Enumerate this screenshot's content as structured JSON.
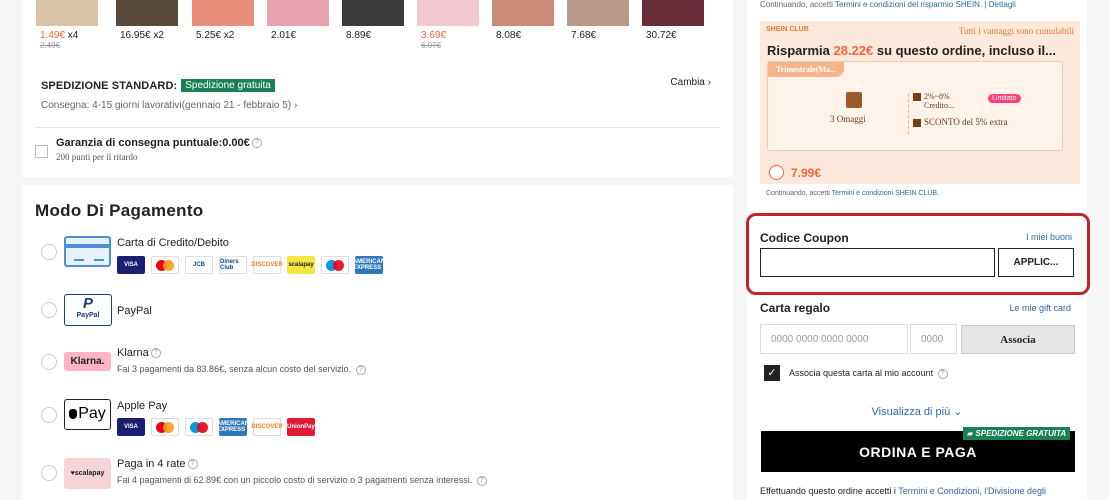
{
  "products": [
    {
      "price": "1.49€",
      "qty": "x4",
      "old": "2.49€",
      "sale": true,
      "color": "#d9c3a8"
    },
    {
      "price": "16.95€",
      "qty": "x2",
      "old": "",
      "sale": false,
      "color": "#5a4a3a"
    },
    {
      "price": "5.25€",
      "qty": "x2",
      "old": "",
      "sale": false,
      "color": "#e88e7a"
    },
    {
      "price": "2.01€",
      "qty": "",
      "old": "",
      "sale": false,
      "color": "#e9a3b0"
    },
    {
      "price": "8.89€",
      "qty": "",
      "old": "",
      "sale": false,
      "color": "#3b3b3b"
    },
    {
      "price": "3.69€",
      "qty": "",
      "old": "6.07€",
      "sale": true,
      "color": "#f2c8d2"
    },
    {
      "price": "8.08€",
      "qty": "",
      "old": "",
      "sale": false,
      "color": "#c98a78"
    },
    {
      "price": "7.68€",
      "qty": "",
      "old": "",
      "sale": false,
      "color": "#b99a8a"
    },
    {
      "price": "30.72€",
      "qty": "",
      "old": "",
      "sale": false,
      "color": "#6a2d3a"
    }
  ],
  "shipping": {
    "name": "SPEDIZIONE STANDARD:",
    "badge": "Spedizione gratuita",
    "eta": "Consegna: 4-15 giorni lavorativi(gennaio 21 - febbraio 5)",
    "change": "Cambia"
  },
  "guarantee": {
    "title": "Garanzia di consegna puntuale:0.00€",
    "sub": "200 punti per il ritardo"
  },
  "payment": {
    "title": "Modo Di Pagamento",
    "methods": {
      "card": {
        "name": "Carta di Credito/Debito"
      },
      "paypal": {
        "name": "PayPal"
      },
      "klarna": {
        "name": "Klarna",
        "sub": "Fai 3 pagamenti da 83.86€, senza alcun costo del servizio."
      },
      "applepay": {
        "name": "Apple Pay"
      },
      "scalapay": {
        "name": "Paga in 4 rate",
        "sub": "Fai 4 pagamenti di 62.89€ con un piccolo costo di servizio o 3 pagamenti senza interessi."
      }
    },
    "card_logos": [
      "VISA",
      "MC",
      "JCB",
      "Diners Club",
      "DISCOVER",
      "scalapay",
      "Maestro",
      "AMERICAN EXPRESS"
    ],
    "apple_logos": [
      "VISA",
      "MC",
      "Maestro",
      "AMERICAN EXPRESS",
      "DISCOVER",
      "UnionPay"
    ],
    "logo_texts": {
      "paypal": "PayPal",
      "klarna": "Klarna.",
      "applepay": "Pay",
      "scalapay": "♥scalapay"
    }
  },
  "right": {
    "note_top": "Continuando, accetti",
    "note_top_link": "Termini e condizioni del risparmio SHEIN.",
    "note_top_link2": "Dettagli",
    "club_tag": "SHEIN CLUB",
    "club_note": "Tutti i vantaggi sono cumulabili",
    "club_head_pre": "Risparmia ",
    "club_head_amt": "28.22€",
    "club_head_post": " su questo ordine, incluso il...",
    "plan": "Trimestrale(Ma...",
    "gifts": "3 Omaggi",
    "perk1a": "2%~8%",
    "perk1b": "Credito...",
    "limit": "Limitato",
    "perk2": "SCONTO del 5% extra",
    "club_price": "7.99€",
    "note_club": "Continuando, accetti",
    "note_club_link": "Termini e condizioni SHEIN CLUB.",
    "coupon_title": "Codice Coupon",
    "my_coupons": "I miei buoni",
    "coupon_btn": "APPLIC...",
    "gift_title": "Carta regalo",
    "gift_link": "Le mie gift card",
    "gift_num_ph": "0000 0000 0000 0000",
    "gift_pin_ph": "0000",
    "gift_btn": "Associa",
    "assoc_label": "Associa questa carta al mio account",
    "more": "Visualizza di più",
    "order": "ORDINA E PAGA",
    "ribbon": "SPEDIZIONE GRATUITA",
    "terms_pre": "Effettuando questo ordine accetti i ",
    "terms_link": "Termini e Condizioni, l'Divisione degli"
  },
  "colors": {
    "accent_orange": "#fa6338",
    "free_green": "#198055",
    "link_blue": "#2d68a8",
    "highlight_red": "#c0272d"
  }
}
